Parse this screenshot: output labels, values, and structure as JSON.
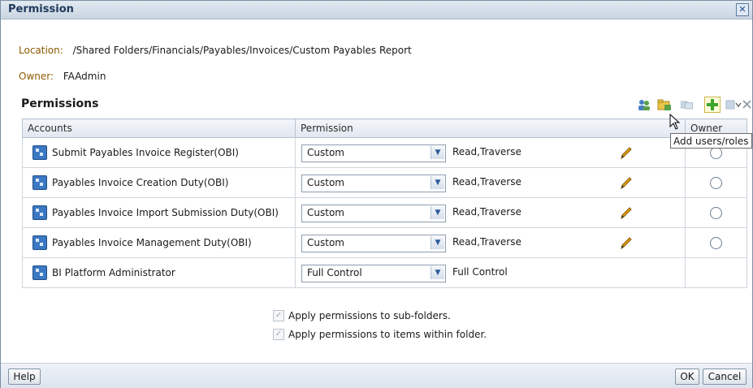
{
  "dialog": {
    "title": "Permission"
  },
  "location": {
    "label": "Location:",
    "value": "/Shared Folders/Financials/Payables/Invoices/Custom Payables Report"
  },
  "owner": {
    "label": "Owner:",
    "value": "FAAdmin"
  },
  "section_title": "Permissions",
  "toolbar": {
    "icons": [
      "users-icon",
      "folder-icon",
      "copy-icon",
      "add-icon",
      "paste-icon",
      "dropdown-icon",
      "delete-icon"
    ],
    "tooltip": "Add users/roles"
  },
  "table": {
    "headers": [
      "Accounts",
      "Permission",
      "Owner"
    ],
    "rows": [
      {
        "account": "Submit Payables Invoice Register(OBI)",
        "permission": "Custom",
        "rights": "Read,Traverse",
        "editable": true,
        "owner_radio": true
      },
      {
        "account": "Payables Invoice Creation Duty(OBI)",
        "permission": "Custom",
        "rights": "Read,Traverse",
        "editable": true,
        "owner_radio": true
      },
      {
        "account": "Payables Invoice Import Submission Duty(OBI)",
        "permission": "Custom",
        "rights": "Read,Traverse",
        "editable": true,
        "owner_radio": true
      },
      {
        "account": "Payables Invoice Management Duty(OBI)",
        "permission": "Custom",
        "rights": "Read,Traverse",
        "editable": true,
        "owner_radio": true
      },
      {
        "account": "BI Platform Administrator",
        "permission": "Full Control",
        "rights": "Full Control",
        "editable": false,
        "owner_radio": false
      }
    ]
  },
  "options": {
    "subfolders": "Apply permissions to sub-folders.",
    "items": "Apply permissions to items within folder.",
    "subfolders_checked": true,
    "items_checked": true
  },
  "buttons": {
    "help": "Help",
    "ok": "OK",
    "cancel": "Cancel"
  },
  "colors": {
    "accent": "#203a5c",
    "label": "#8c5a00",
    "add_green": "#3aa52b"
  }
}
